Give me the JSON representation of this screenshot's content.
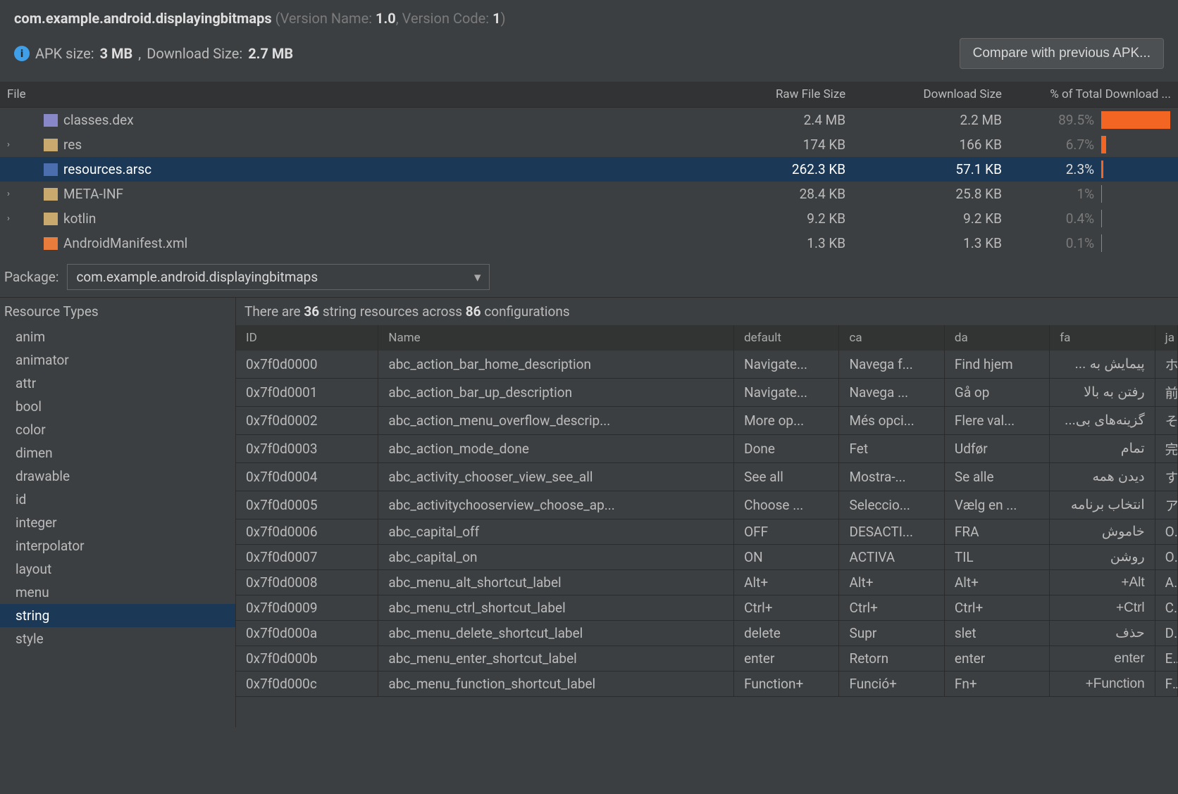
{
  "header": {
    "package": "com.example.android.displayingbitmaps",
    "version_name_label": "Version Name:",
    "version_name": "1.0",
    "version_code_label": "Version Code:",
    "version_code": "1",
    "apk_size_label": "APK size:",
    "apk_size": "3 MB",
    "download_size_label": "Download Size:",
    "download_size": "2.7 MB",
    "compare_btn": "Compare with previous APK..."
  },
  "tree": {
    "columns": [
      "File",
      "Raw File Size",
      "Download Size",
      "% of Total Download ..."
    ],
    "rows": [
      {
        "name": "classes.dex",
        "raw": "2.4 MB",
        "dl": "2.2 MB",
        "pct": "89.5%",
        "bar": 89.5,
        "expand": false,
        "icon": "file"
      },
      {
        "name": "res",
        "raw": "174 KB",
        "dl": "166 KB",
        "pct": "6.7%",
        "bar": 6.7,
        "expand": true,
        "icon": "folder"
      },
      {
        "name": "resources.arsc",
        "raw": "262.3 KB",
        "dl": "57.1 KB",
        "pct": "2.3%",
        "bar": 2.3,
        "expand": false,
        "icon": "arsc",
        "sel": true
      },
      {
        "name": "META-INF",
        "raw": "28.4 KB",
        "dl": "25.8 KB",
        "pct": "1%",
        "bar": 1,
        "expand": true,
        "icon": "folder"
      },
      {
        "name": "kotlin",
        "raw": "9.2 KB",
        "dl": "9.2 KB",
        "pct": "0.4%",
        "bar": 0.4,
        "expand": true,
        "icon": "folder"
      },
      {
        "name": "AndroidManifest.xml",
        "raw": "1.3 KB",
        "dl": "1.3 KB",
        "pct": "0.1%",
        "bar": 0.1,
        "expand": false,
        "icon": "xml"
      }
    ]
  },
  "package_selector": {
    "label": "Package:",
    "value": "com.example.android.displayingbitmaps"
  },
  "resource_types": {
    "title": "Resource Types",
    "items": [
      "anim",
      "animator",
      "attr",
      "bool",
      "color",
      "dimen",
      "drawable",
      "id",
      "integer",
      "interpolator",
      "layout",
      "menu",
      "string",
      "style"
    ],
    "selected": "string"
  },
  "resources_info": {
    "prefix": "There are",
    "count": "36",
    "mid": "string resources across",
    "configs": "86",
    "suffix": "configurations"
  },
  "res_table": {
    "columns": [
      "ID",
      "Name",
      "default",
      "ca",
      "da",
      "fa",
      "ja"
    ],
    "rows": [
      {
        "id": "0x7f0d0000",
        "name": "abc_action_bar_home_description",
        "default": "Navigate...",
        "ca": "Navega f...",
        "da": "Find hjem",
        "fa": "پیمایش به ...",
        "ja": "ホ"
      },
      {
        "id": "0x7f0d0001",
        "name": "abc_action_bar_up_description",
        "default": "Navigate...",
        "ca": "Navega ...",
        "da": "Gå op",
        "fa": "رفتن به بالا",
        "ja": "前"
      },
      {
        "id": "0x7f0d0002",
        "name": "abc_action_menu_overflow_descrip...",
        "default": "More op...",
        "ca": "Més opci...",
        "da": "Flere val...",
        "fa": "گزینه‌های بی...",
        "ja": "そ"
      },
      {
        "id": "0x7f0d0003",
        "name": "abc_action_mode_done",
        "default": "Done",
        "ca": "Fet",
        "da": "Udfør",
        "fa": "تمام",
        "ja": "完"
      },
      {
        "id": "0x7f0d0004",
        "name": "abc_activity_chooser_view_see_all",
        "default": "See all",
        "ca": "Mostra-...",
        "da": "Se alle",
        "fa": "دیدن همه",
        "ja": "す"
      },
      {
        "id": "0x7f0d0005",
        "name": "abc_activitychooserview_choose_ap...",
        "default": "Choose ...",
        "ca": "Seleccio...",
        "da": "Vælg en ...",
        "fa": "انتخاب برنامه",
        "ja": "ア"
      },
      {
        "id": "0x7f0d0006",
        "name": "abc_capital_off",
        "default": "OFF",
        "ca": "DESACTI...",
        "da": "FRA",
        "fa": "خاموش",
        "ja": "O"
      },
      {
        "id": "0x7f0d0007",
        "name": "abc_capital_on",
        "default": "ON",
        "ca": "ACTIVA",
        "da": "TIL",
        "fa": "روشن",
        "ja": "O"
      },
      {
        "id": "0x7f0d0008",
        "name": "abc_menu_alt_shortcut_label",
        "default": "Alt+",
        "ca": "Alt+",
        "da": "Alt+",
        "fa": "Alt+",
        "ja": "A"
      },
      {
        "id": "0x7f0d0009",
        "name": "abc_menu_ctrl_shortcut_label",
        "default": "Ctrl+",
        "ca": "Ctrl+",
        "da": "Ctrl+",
        "fa": "Ctrl+",
        "ja": "C"
      },
      {
        "id": "0x7f0d000a",
        "name": "abc_menu_delete_shortcut_label",
        "default": "delete",
        "ca": "Supr",
        "da": "slet",
        "fa": "حذف",
        "ja": "D"
      },
      {
        "id": "0x7f0d000b",
        "name": "abc_menu_enter_shortcut_label",
        "default": "enter",
        "ca": "Retorn",
        "da": "enter",
        "fa": "enter",
        "ja": "Er"
      },
      {
        "id": "0x7f0d000c",
        "name": "abc_menu_function_shortcut_label",
        "default": "Function+",
        "ca": "Funció+",
        "da": "Fn+",
        "fa": "Function+",
        "ja": "Fu"
      }
    ]
  }
}
